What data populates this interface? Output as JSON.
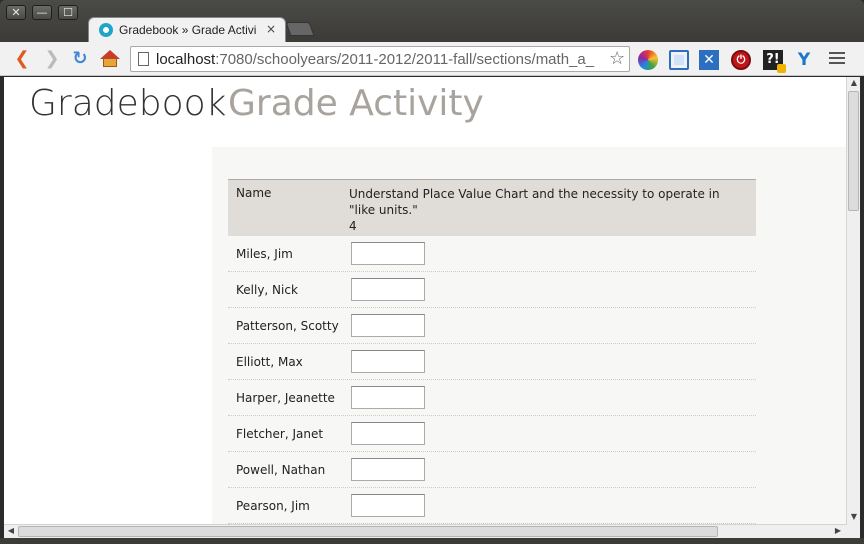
{
  "window": {
    "close_glyph": "✕",
    "minimize_glyph": "—",
    "maximize_glyph": "☐"
  },
  "tab": {
    "title": "Gradebook » Grade Activi",
    "close_glyph": "×"
  },
  "toolbar": {
    "back_glyph": "❮",
    "forward_glyph": "❯",
    "reload_glyph": "↻",
    "url_host": "localhost",
    "url_rest": ":7080/schoolyears/2011-2012/2011-fall/sections/math_a_",
    "star_glyph": "☆",
    "ext_x_glyph": "✕",
    "ext_stop_glyph": "⏻",
    "ext_help_glyph": "?!",
    "ext_y_glyph": "Y"
  },
  "page": {
    "title": "Gradebook",
    "subtitle": "Grade Activity"
  },
  "table": {
    "name_header": "Name",
    "activity_title": "Understand Place Value Chart and the necessity to operate in \"like units.\"",
    "activity_points": "4",
    "students": [
      {
        "name": "Miles, Jim",
        "score": ""
      },
      {
        "name": "Kelly, Nick",
        "score": ""
      },
      {
        "name": "Patterson, Scotty",
        "score": ""
      },
      {
        "name": "Elliott, Max",
        "score": ""
      },
      {
        "name": "Harper, Jeanette",
        "score": ""
      },
      {
        "name": "Fletcher, Janet",
        "score": ""
      },
      {
        "name": "Powell, Nathan",
        "score": ""
      },
      {
        "name": "Pearson, Jim",
        "score": ""
      }
    ]
  },
  "scrollbars": {
    "up_glyph": "▲",
    "down_glyph": "▼",
    "left_glyph": "◀",
    "right_glyph": "▶"
  },
  "colors": {
    "header_row_bg": "#e0ddd8",
    "subtitle_gray": "#a8a39c",
    "content_bg": "#f7f7f6"
  }
}
